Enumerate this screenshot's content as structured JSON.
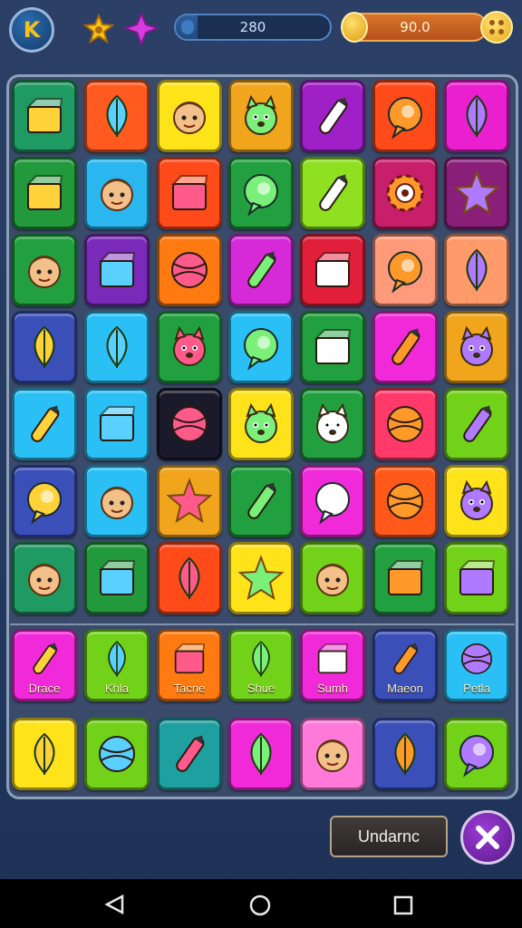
{
  "hud": {
    "profile_letter": "K",
    "progress_label": "280",
    "progress_fraction": 0.14,
    "gold_label": "90.0",
    "icons": [
      "star-icon",
      "gem-icon",
      "coin-icon",
      "coin-plus-icon"
    ]
  },
  "colors": {
    "background": "#263b62",
    "board": "#3a4a6a",
    "accent_gold": "#e8a81b",
    "accent_blue": "#4f84c4"
  },
  "board": {
    "rows": [
      [
        {
          "color": "#1f9a62",
          "icon": "jar-icon"
        },
        {
          "color": "#ff5a1f",
          "icon": "leaf-icon"
        },
        {
          "color": "#ffe31a",
          "icon": "boy-face-icon"
        },
        {
          "color": "#f0a51c",
          "icon": "cat-face-icon"
        },
        {
          "color": "#a020c8",
          "icon": "faucet-icon"
        },
        {
          "color": "#ff4a1a",
          "icon": "monster-icon"
        },
        {
          "color": "#e91fd0",
          "icon": "bird-icon"
        }
      ],
      [
        {
          "color": "#229a3c",
          "icon": "hat-icon"
        },
        {
          "color": "#2ab7f0",
          "icon": "boy-face-icon"
        },
        {
          "color": "#ff4a1a",
          "icon": "gift-box-icon"
        },
        {
          "color": "#22a040",
          "icon": "balloon-icon"
        },
        {
          "color": "#8fe020",
          "icon": "pencil-icon"
        },
        {
          "color": "#c81f6a",
          "icon": "gear-icon"
        },
        {
          "color": "#8a1f7a",
          "icon": "star-icon"
        }
      ],
      [
        {
          "color": "#22a040",
          "icon": "chick-icon"
        },
        {
          "color": "#7a2ab8",
          "icon": "shield-icon"
        },
        {
          "color": "#ff7a10",
          "icon": "ball-icon"
        },
        {
          "color": "#d62ad8",
          "icon": "crayon-icon"
        },
        {
          "color": "#e21f3a",
          "icon": "can-icon"
        },
        {
          "color": "#ff9a7a",
          "icon": "balloon-icon"
        },
        {
          "color": "#ff9a6a",
          "icon": "shell-icon"
        }
      ],
      [
        {
          "color": "#3a4fb8",
          "icon": "feather-icon"
        },
        {
          "color": "#2ac0f5",
          "icon": "bird-icon"
        },
        {
          "color": "#22a040",
          "icon": "hippo-icon"
        },
        {
          "color": "#2ac0f5",
          "icon": "mushroom-icon"
        },
        {
          "color": "#22a040",
          "icon": "battery-icon"
        },
        {
          "color": "#f02ad8",
          "icon": "sword-icon"
        },
        {
          "color": "#f0a51c",
          "icon": "frog-icon"
        }
      ],
      [
        {
          "color": "#2ac0f5",
          "icon": "horn-icon"
        },
        {
          "color": "#2ac0f5",
          "icon": "cup-icon"
        },
        {
          "color": "#1a1a2a",
          "icon": "fish-icon"
        },
        {
          "color": "#ffe31a",
          "icon": "lion-icon"
        },
        {
          "color": "#22a040",
          "icon": "cat-icon"
        },
        {
          "color": "#ff3a6a",
          "icon": "compass-icon"
        },
        {
          "color": "#72d21a",
          "icon": "sword-icon"
        }
      ],
      [
        {
          "color": "#3a4fb8",
          "icon": "heart-x-icon"
        },
        {
          "color": "#2ac0f5",
          "icon": "girl-face-icon"
        },
        {
          "color": "#f0a51c",
          "icon": "starfish-icon"
        },
        {
          "color": "#22a040",
          "icon": "rocket-icon"
        },
        {
          "color": "#f02ad8",
          "icon": "umbrella-icon"
        },
        {
          "color": "#ff5a1a",
          "icon": "swirl-icon"
        },
        {
          "color": "#ffe31a",
          "icon": "bear-face-icon"
        }
      ],
      [
        {
          "color": "#1f9a62",
          "icon": "boy-face-icon"
        },
        {
          "color": "#229a3c",
          "icon": "box-icon"
        },
        {
          "color": "#ff4a1a",
          "icon": "shell-icon"
        },
        {
          "color": "#ffe31a",
          "icon": "sun-icon"
        },
        {
          "color": "#72d21a",
          "icon": "girl-face-icon"
        },
        {
          "color": "#22a040",
          "icon": "lantern-icon"
        },
        {
          "color": "#72d21a",
          "icon": "note-icon"
        }
      ],
      [
        {
          "color": "#f02ad8",
          "icon": "crayon-icon",
          "label": "Drace"
        },
        {
          "color": "#72d21a",
          "icon": "tree-icon",
          "label": "Khla"
        },
        {
          "color": "#ff7a10",
          "icon": "can-icon",
          "label": "Tacne"
        },
        {
          "color": "#72d21a",
          "icon": "shell-icon",
          "label": "Shue"
        },
        {
          "color": "#f02ad8",
          "icon": "cup-icon",
          "label": "Sumh"
        },
        {
          "color": "#3a4fb8",
          "icon": "lamp-icon",
          "label": "Maeon"
        },
        {
          "color": "#2ac0f5",
          "icon": "fish-icon",
          "label": "Petla"
        }
      ],
      [
        {
          "color": "#ffe31a",
          "icon": "leaf-icon"
        },
        {
          "color": "#72d21a",
          "icon": "drum-icon"
        },
        {
          "color": "#1fa0a0",
          "icon": "wand-icon"
        },
        {
          "color": "#f02ad8",
          "icon": "shell-icon"
        },
        {
          "color": "#ff7ad8",
          "icon": "gnome-face-icon"
        },
        {
          "color": "#3a4fb8",
          "icon": "leaf-icon"
        },
        {
          "color": "#72d21a",
          "icon": "bubble-icon"
        }
      ]
    ]
  },
  "action_button": {
    "label": "Undarnc"
  },
  "close_button": {
    "icon": "close-icon"
  },
  "navbar": {
    "icons": [
      "back-icon",
      "home-icon",
      "recent-apps-icon"
    ]
  }
}
